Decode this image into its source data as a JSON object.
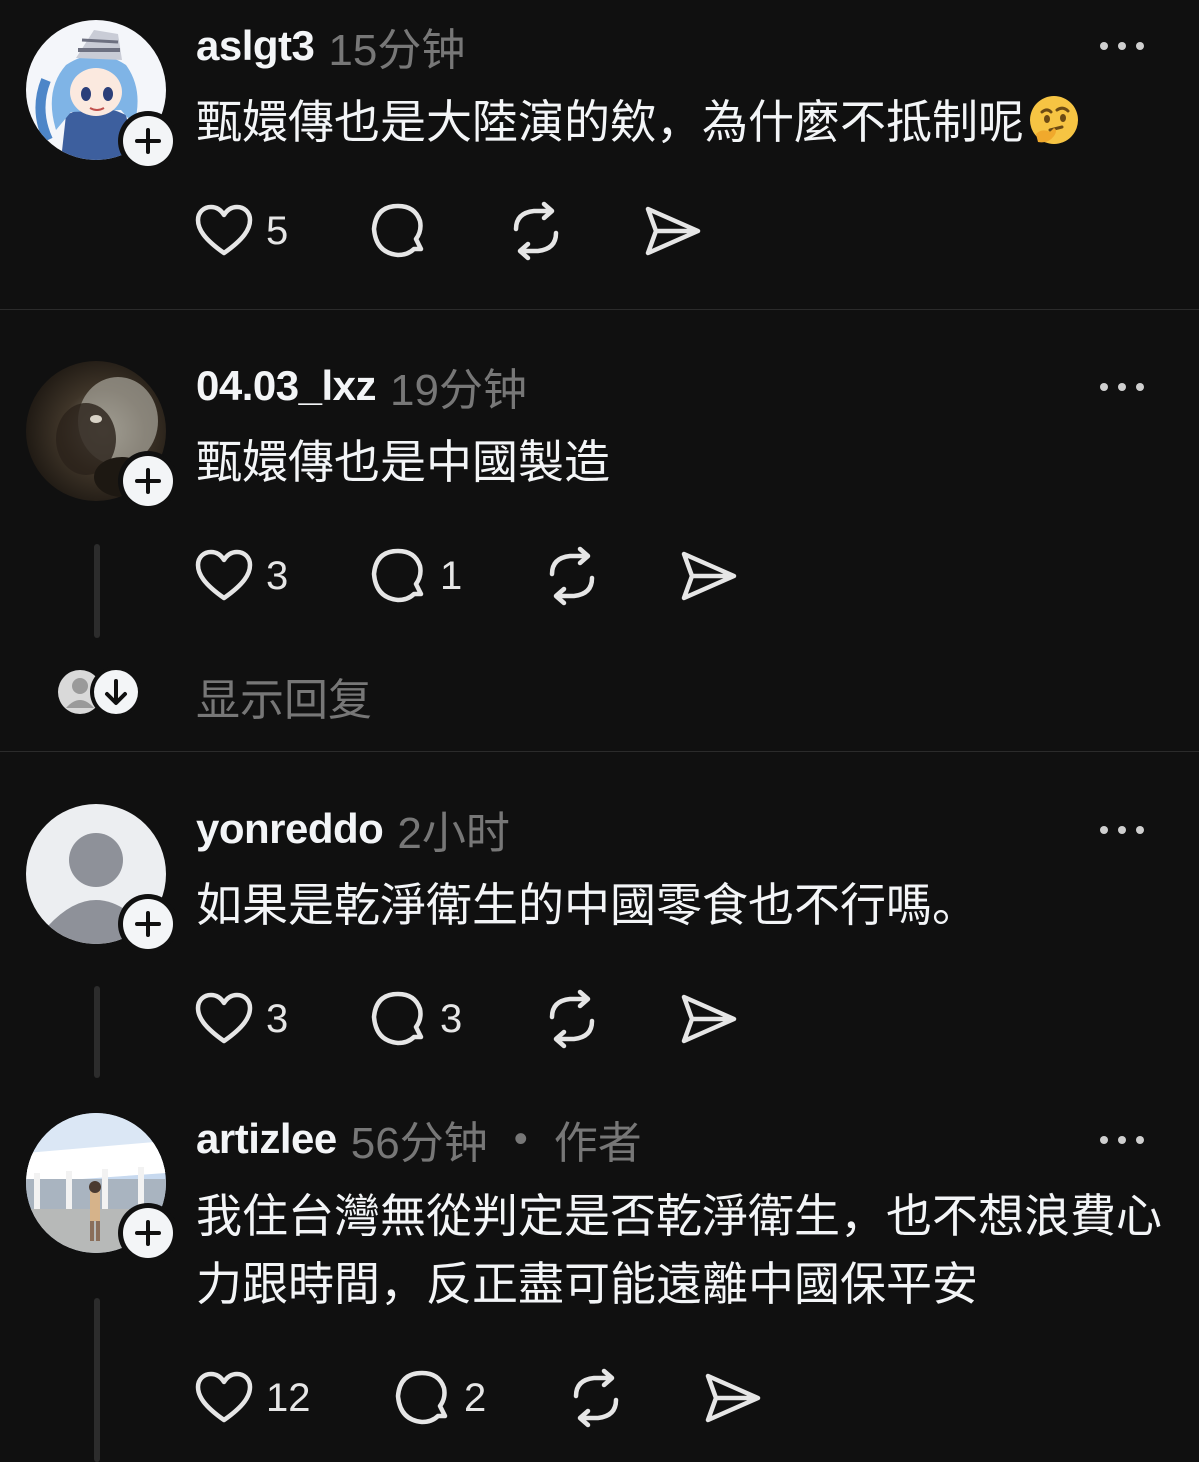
{
  "posts": [
    {
      "username": "aslgt3",
      "time": "15分钟",
      "text": "甄嬛傳也是大陸演的欸，為什麼不抵制呢",
      "emoji": "thinking-face",
      "likes": "5",
      "replies": "",
      "avatar": "anime-character"
    },
    {
      "username": "04.03_lxz",
      "time": "19分钟",
      "text": "甄嬛傳也是中國製造",
      "likes": "3",
      "replies": "1",
      "avatar": "dark-photo"
    },
    {
      "username": "yonreddo",
      "time": "2小时",
      "text": "如果是乾淨衛生的中國零食也不行嗎。",
      "likes": "3",
      "replies": "3",
      "avatar": "default-person"
    },
    {
      "username": "artizlee",
      "time": "56分钟",
      "author_label": "作者",
      "text": "我住台灣無從判定是否乾淨衛生，也不想浪費心力跟時間，反正盡可能遠離中國保平安",
      "likes": "12",
      "replies": "2",
      "avatar": "outdoor-photo"
    }
  ],
  "show_replies_label": "显示回复",
  "colors": {
    "background": "#101010",
    "text_primary": "#f3f5f7",
    "text_secondary": "#777777",
    "divider": "#2b2b2b"
  }
}
